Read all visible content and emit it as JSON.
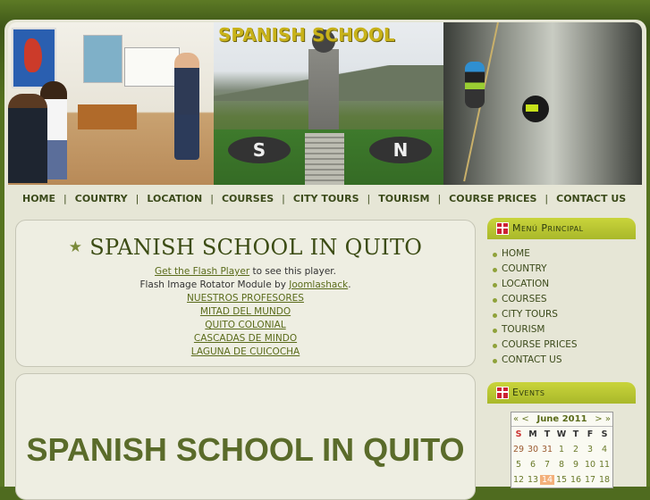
{
  "site": {
    "title": "SPANISH SCHOOL"
  },
  "nav": [
    "HOME",
    "COUNTRY",
    "LOCATION",
    "COURSES",
    "CITY TOURS",
    "TOURISM",
    "COURSE PRICES",
    "CONTACT US"
  ],
  "main": {
    "title": "SPANISH SCHOOL IN QUITO",
    "flash_link": "Get the Flash Player",
    "flash_text": " to see this player.",
    "module_text": "Flash Image Rotator Module by ",
    "module_link": "Joomlashack",
    "module_suffix": ".",
    "links": [
      "NUESTROS PROFESORES",
      "MITAD DEL MUNDO",
      "QUITO COLONIAL",
      "CASCADAS DE MINDO",
      "LAGUNA DE CUICOCHA"
    ]
  },
  "article": {
    "title": "SPANISH SCHOOL IN QUITO"
  },
  "sidebar": {
    "menu_title": "Menú Principal",
    "menu": [
      "HOME",
      "COUNTRY",
      "LOCATION",
      "COURSES",
      "CITY TOURS",
      "TOURISM",
      "COURSE PRICES",
      "CONTACT US"
    ],
    "events_title": "Events"
  },
  "calendar": {
    "prev_year": "«",
    "prev_month": "<",
    "month": "June 2011",
    "next_month": ">",
    "next_year": "»",
    "days": [
      "S",
      "M",
      "T",
      "W",
      "T",
      "F",
      "S"
    ],
    "rows": [
      [
        "29",
        "30",
        "31",
        "1",
        "2",
        "3",
        "4"
      ],
      [
        "5",
        "6",
        "7",
        "8",
        "9",
        "10",
        "11"
      ],
      [
        "12",
        "13",
        "14",
        "15",
        "16",
        "17",
        "18"
      ]
    ],
    "today": "14"
  }
}
